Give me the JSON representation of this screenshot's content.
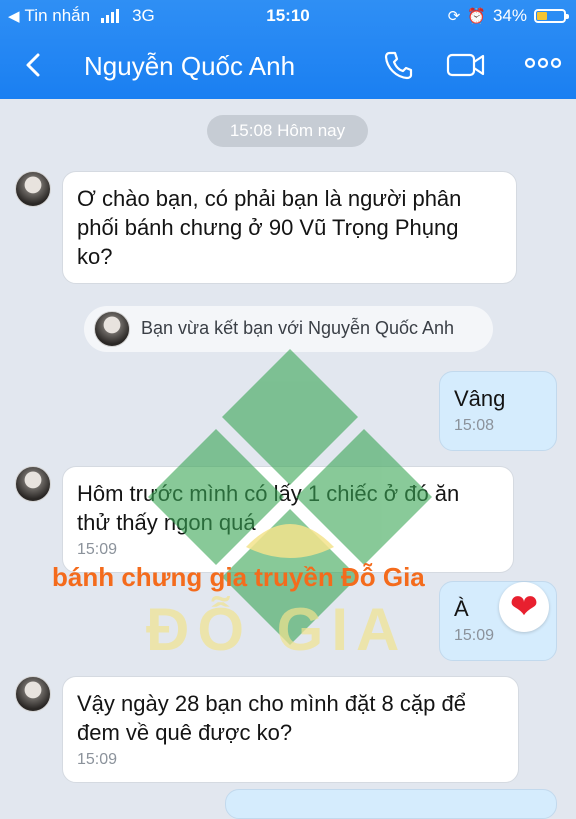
{
  "status_bar": {
    "carrier": "Tin nhắn",
    "network": "3G",
    "time": "15:10",
    "battery": "34%"
  },
  "header": {
    "title": "Nguyễn Quốc Anh",
    "icons": [
      "back-chevron-icon",
      "phone-icon",
      "video-call-icon",
      "more-icon"
    ]
  },
  "chat": {
    "date_pill": "15:08 Hôm nay",
    "system_note": "Bạn vừa kết bạn với Nguyễn Quốc Anh",
    "messages": [
      {
        "from": "contact",
        "text_lines": [
          "Ơ chào bạn, có phải bạn là người phân",
          "phối bánh chưng ở 90 Vũ Trọng Phụng",
          "ko?"
        ],
        "time": ""
      },
      {
        "from": "me",
        "text_lines": [
          "Vâng"
        ],
        "time": "15:08"
      },
      {
        "from": "contact",
        "text_lines": [
          "Hôm trước mình có lấy 1 chiếc ở đó ăn",
          "thử thấy ngon quá"
        ],
        "time": "15:09"
      },
      {
        "from": "me",
        "text_lines": [
          "À"
        ],
        "time": "15:09",
        "reaction": "heart"
      },
      {
        "from": "contact",
        "text_lines": [
          "Vậy ngày 28 bạn cho mình đặt 8 cặp để",
          "đem về quê được ko?"
        ],
        "time": "15:09"
      }
    ]
  },
  "watermark": {
    "caption": "bánh chưng gia truyền Đỗ Gia",
    "logo_text": "ĐỖ GIA",
    "colors": {
      "diamond": "#3aa655",
      "caption": "#f46b1c",
      "logo": "#f1e38f"
    }
  },
  "colors": {
    "header": "#1a7ff2",
    "background": "#e2e7ef",
    "out_bubble": "#d5ecfd",
    "in_bubble": "#ffffff"
  }
}
